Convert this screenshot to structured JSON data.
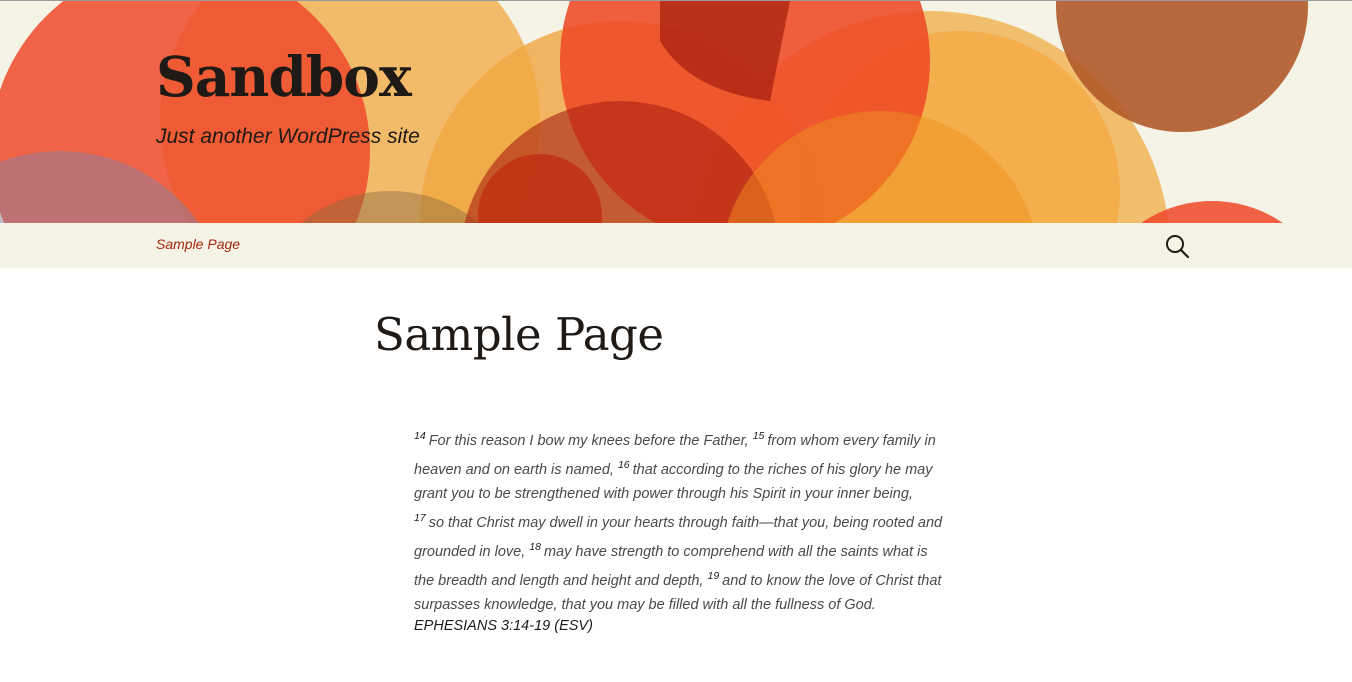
{
  "site": {
    "title": "Sandbox",
    "description": "Just another WordPress site"
  },
  "nav": {
    "items": [
      {
        "label": "Sample Page"
      }
    ],
    "search_icon": "search-icon"
  },
  "page": {
    "title": "Sample Page",
    "verses": [
      {
        "num": "14",
        "text": "For this reason I bow my knees before the Father,"
      },
      {
        "num": "15",
        "text": "from whom every family in heaven and on earth is named,"
      },
      {
        "num": "16",
        "text": "that according to the riches of his glory he may grant you to be strengthened with power through his Spirit in your inner being,"
      },
      {
        "num": "17",
        "text": "so that Christ may dwell in your hearts through faith—that you, being rooted and grounded in love,"
      },
      {
        "num": "18",
        "text": "may have strength to comprehend with all the saints what is the breadth and length and height and depth,"
      },
      {
        "num": "19",
        "text": "and to know the love of Christ that surpasses knowledge, that you may be filled with all the fullness of God."
      }
    ],
    "citation": "EPHESIANS 3:14-19 (ESV)"
  },
  "colors": {
    "header_bg": "#f5f2e6",
    "link": "#a72810",
    "text": "#1f1a16"
  }
}
